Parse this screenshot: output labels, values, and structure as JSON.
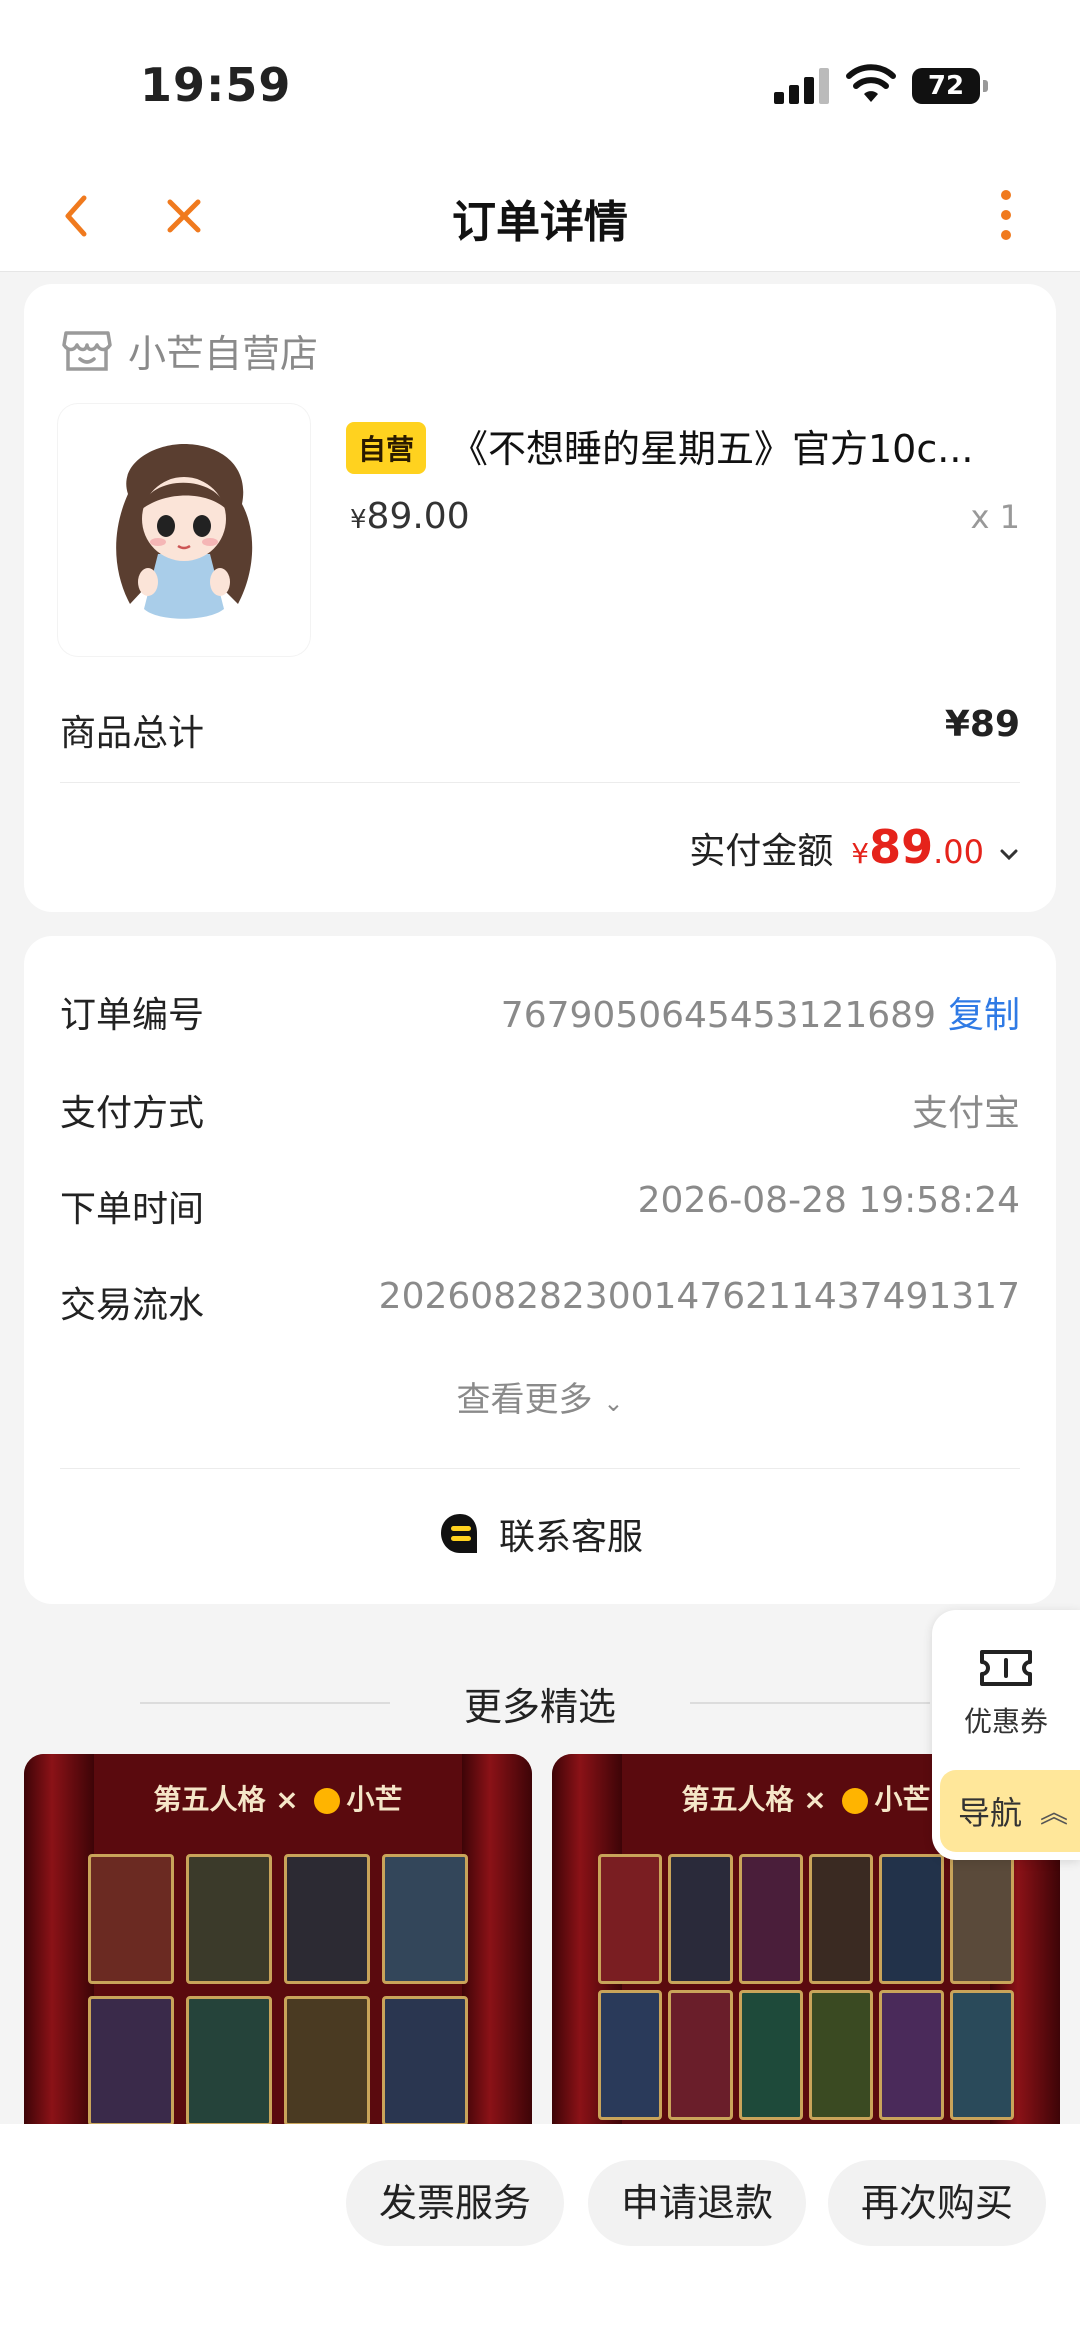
{
  "status": {
    "time": "19:59",
    "battery": "72"
  },
  "nav": {
    "title": "订单详情"
  },
  "order": {
    "store_name": "小芒自营店",
    "tag": "自营",
    "product_name": "《不想睡的星期五》官方10c...",
    "price_symbol": "¥",
    "price": "89.00",
    "quantity": "x 1",
    "subtotal_label": "商品总计",
    "subtotal_value": "¥89",
    "paid_label": "实付金额",
    "paid_symbol": "¥",
    "paid_int": "89",
    "paid_dec": ".00"
  },
  "details": {
    "rows": [
      {
        "key": "订单编号",
        "value": "767905064545312 1689"
      },
      {
        "key": "支付方式",
        "value": "支付宝"
      },
      {
        "key": "下单时间",
        "value": "2026-08-28 19:58:24"
      },
      {
        "key": "交易流水",
        "value": "2026082823001476211437491317"
      }
    ],
    "order_no": "7679050645453121689",
    "copy_label": "复制",
    "see_more": "查看更多",
    "service": "联系客服"
  },
  "more": {
    "title": "更多精选",
    "logo_left": "第五人格",
    "logo_right": "小芒"
  },
  "floating": {
    "coupon": "优惠券",
    "nav": "导航"
  },
  "bottom": {
    "invoice": "发票服务",
    "refund": "申请退款",
    "rebuy": "再次购买"
  },
  "colors": {
    "accent": "#f07a1e",
    "price": "#e5231b",
    "link": "#2f7ae5",
    "tag": "#ffd21f"
  }
}
